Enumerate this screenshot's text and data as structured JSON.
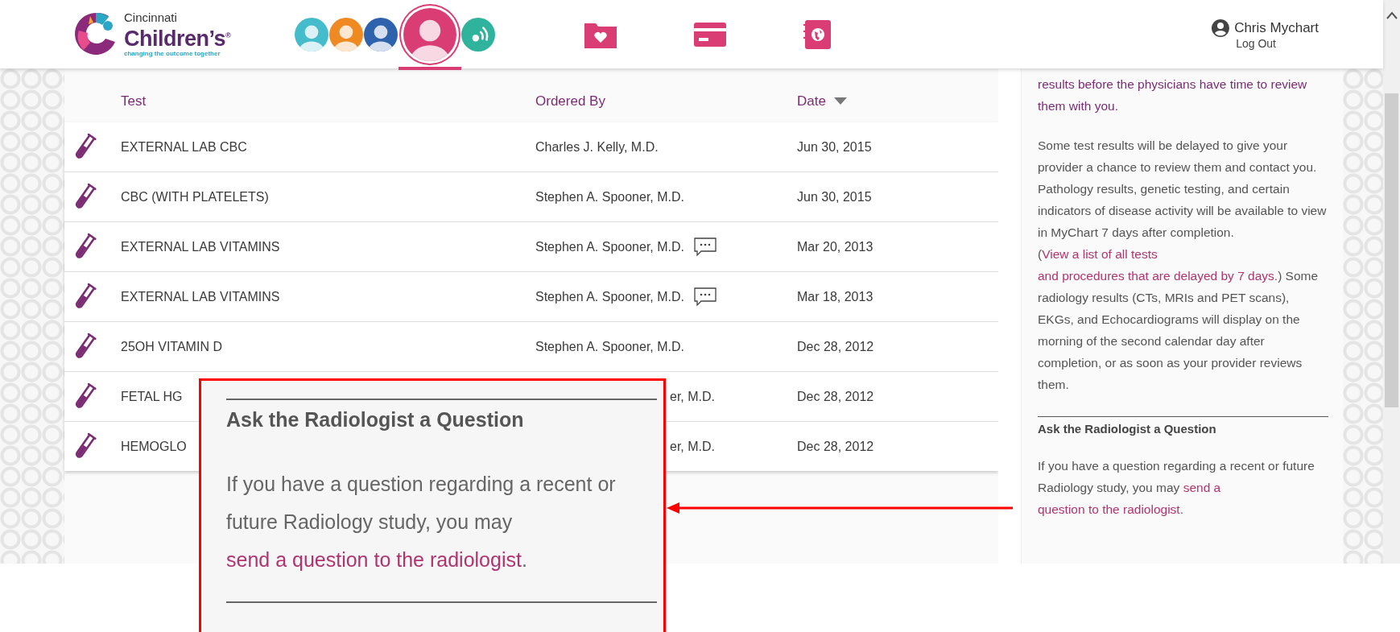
{
  "header": {
    "logo": {
      "line1": "Cincinnati",
      "line2": "Children’s$^{®}$",
      "tagline": "changing the outcome together"
    },
    "patients": [
      {
        "color": "#45bccb",
        "selected": false,
        "kind": "person"
      },
      {
        "color": "#ef8a22",
        "selected": false,
        "kind": "person"
      },
      {
        "color": "#2f62ad",
        "selected": false,
        "kind": "person"
      },
      {
        "color": "#d93d74",
        "selected": true,
        "kind": "person"
      },
      {
        "color": "#2fb39c",
        "selected": false,
        "kind": "signal"
      }
    ],
    "user": {
      "name": "Chris Mychart",
      "logout": "Log Out"
    }
  },
  "table": {
    "columns": [
      {
        "label": "Test",
        "sorted": false
      },
      {
        "label": "Ordered By",
        "sorted": false
      },
      {
        "label": "Date",
        "sorted": true
      }
    ],
    "rows": [
      {
        "test": "EXTERNAL LAB CBC",
        "ordered_by": "Charles J. Kelly, M.D.",
        "comment": false,
        "date": "Jun 30, 2015",
        "covered": false
      },
      {
        "test": "CBC (WITH PLATELETS)",
        "ordered_by": "Stephen A. Spooner, M.D.",
        "comment": false,
        "date": "Jun 30, 2015",
        "covered": false
      },
      {
        "test": "EXTERNAL LAB VITAMINS",
        "ordered_by": "Stephen A. Spooner, M.D.",
        "comment": true,
        "date": "Mar 20, 2013",
        "covered": false
      },
      {
        "test": "EXTERNAL LAB VITAMINS",
        "ordered_by": "Stephen A. Spooner, M.D.",
        "comment": true,
        "date": "Mar 18, 2013",
        "covered": false
      },
      {
        "test": "25OH VITAMIN D",
        "ordered_by": "Stephen A. Spooner, M.D.",
        "comment": false,
        "date": "Dec 28, 2012",
        "covered": false
      },
      {
        "test": "FETAL HG",
        "ordered_by": "er, M.D.",
        "comment": false,
        "date": "Dec 28, 2012",
        "covered": true
      },
      {
        "test": "HEMOGLO",
        "ordered_by": "er, M.D.",
        "comment": false,
        "date": "Dec 28, 2012",
        "covered": true
      }
    ]
  },
  "sidebar": {
    "intro": "results before the physicians have time to review them with you.",
    "notice": [
      {
        "kind": "text",
        "text": "Some test results will be delayed to give your provider a chance to review them and contact you. Pathology results, genetic testing, and certain indicators of disease activity will be available to view in MyChart 7 days after completion. ("
      },
      {
        "kind": "link",
        "text": "View a list of all tests"
      },
      {
        "kind": "link",
        "text": "and procedures that are delayed by 7 days."
      },
      {
        "kind": "text",
        "text": ") Some radiology results (CTs, MRIs and PET scans), EKGs, and Echocardiograms will display on the morning of the second calendar day after completion, or as soon as your provider reviews them."
      }
    ],
    "heading": "Ask the Radiologist a Question",
    "question": [
      {
        "kind": "text",
        "text": "If you have a question regarding a recent or future Radiology study, you may "
      },
      {
        "kind": "link",
        "text": "send a"
      },
      {
        "kind": "link",
        "text": "question to the radiologist"
      },
      {
        "kind": "text",
        "text": "."
      }
    ]
  },
  "callout": {
    "heading": "Ask the Radiologist a Question",
    "text": [
      {
        "kind": "text",
        "text": "If you have a question regarding a recent or future Radiology study, you may "
      },
      {
        "kind": "link",
        "text": "send a question to the radiologist"
      },
      {
        "kind": "text",
        "text": "."
      }
    ]
  }
}
